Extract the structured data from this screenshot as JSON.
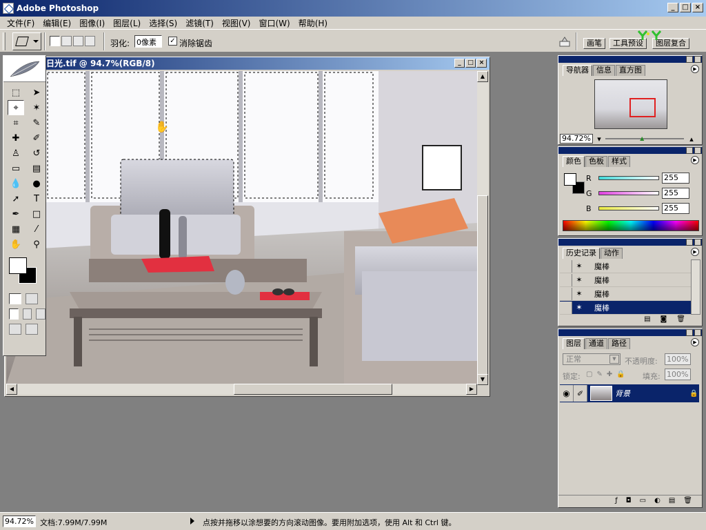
{
  "app": {
    "title": "Adobe Photoshop",
    "window_buttons": [
      "_",
      "□",
      "×"
    ]
  },
  "menu": [
    "文件(F)",
    "编辑(E)",
    "图像(I)",
    "图层(L)",
    "选择(S)",
    "滤镜(T)",
    "视图(V)",
    "窗口(W)",
    "帮助(H)"
  ],
  "options": {
    "feather_label": "羽化:",
    "feather_value": "0像素",
    "antialias_checked": "✓",
    "antialias_label": "消除锯齿",
    "palette_well_tabs": [
      "画笔",
      "工具预设",
      "图层复合"
    ]
  },
  "document": {
    "title": "日光.tif @ 94.7%(RGB/8)"
  },
  "navigator": {
    "tabs": [
      "导航器",
      "信息",
      "直方图"
    ],
    "zoom": "94.72%"
  },
  "color": {
    "tabs": [
      "颜色",
      "色板",
      "样式"
    ],
    "channels": [
      {
        "label": "R",
        "value": "255",
        "color": "#40d8d8"
      },
      {
        "label": "G",
        "value": "255",
        "color": "#e040e0"
      },
      {
        "label": "B",
        "value": "255",
        "color": "#e8e840"
      }
    ]
  },
  "history": {
    "tabs": [
      "历史记录",
      "动作"
    ],
    "items": [
      "魔棒",
      "魔棒",
      "魔棒",
      "魔棒"
    ],
    "selected_index": 3
  },
  "layers": {
    "tabs": [
      "图层",
      "通道",
      "路径"
    ],
    "blend_mode": "正常",
    "opacity_label": "不透明度:",
    "opacity_value": "100%",
    "lock_label": "锁定:",
    "fill_label": "填充:",
    "fill_value": "100%",
    "layer_name": "背景"
  },
  "status": {
    "zoom": "94.72%",
    "doc": "文档:7.99M/7.99M",
    "hint": "点按并拖移以涂想要的方向滚动图像。要用附加选项，使用 Alt 和 Ctrl 键。"
  },
  "colors": {
    "titlebar": "#0a246a",
    "chrome": "#d4d0c8",
    "workspace": "#808080",
    "selection": "#0a246a"
  }
}
